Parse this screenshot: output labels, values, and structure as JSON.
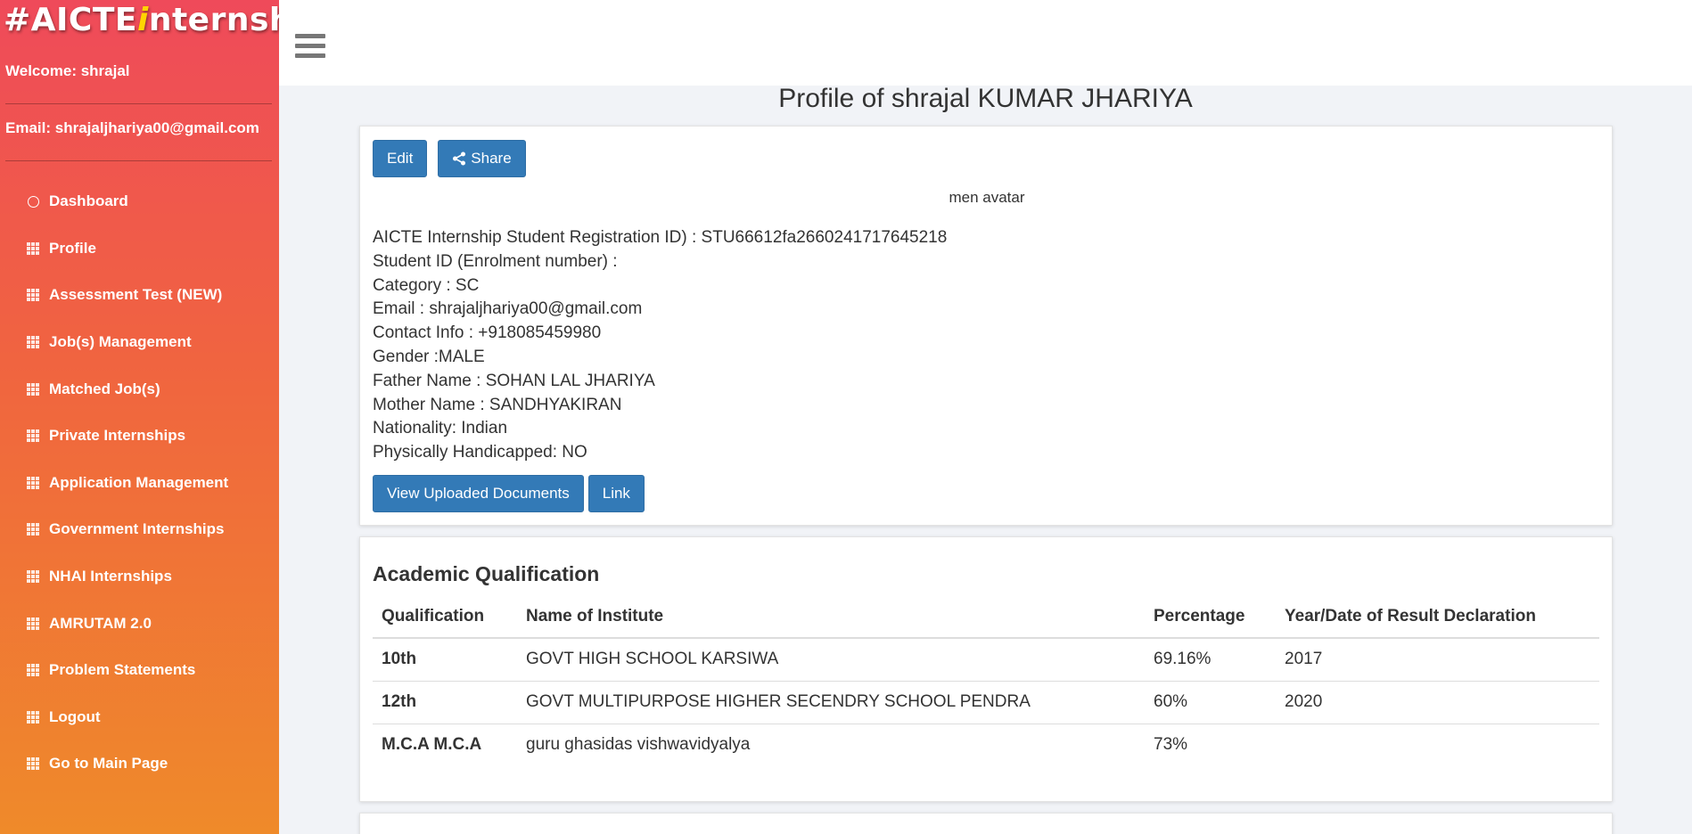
{
  "sidebar": {
    "logo_hash": "#AICTE",
    "logo_i": "i",
    "logo_rest": "nternship",
    "welcome": "Welcome: shrajal",
    "email": "Email: shrajaljhariya00@gmail.com",
    "items": [
      {
        "label": "Dashboard",
        "icon": "circle-icon"
      },
      {
        "label": "Profile",
        "icon": "grid-icon"
      },
      {
        "label": "Assessment Test (NEW)",
        "icon": "grid-icon"
      },
      {
        "label": "Job(s) Management",
        "icon": "grid-icon"
      },
      {
        "label": "Matched Job(s)",
        "icon": "grid-icon"
      },
      {
        "label": "Private Internships",
        "icon": "grid-icon"
      },
      {
        "label": "Application Management",
        "icon": "grid-icon"
      },
      {
        "label": "Government Internships",
        "icon": "grid-icon"
      },
      {
        "label": "NHAI Internships",
        "icon": "grid-icon"
      },
      {
        "label": "AMRUTAM 2.0",
        "icon": "grid-icon"
      },
      {
        "label": "Problem Statements",
        "icon": "grid-icon"
      },
      {
        "label": "Logout",
        "icon": "grid-icon"
      },
      {
        "label": "Go to Main Page",
        "icon": "grid-icon"
      }
    ]
  },
  "header": {
    "menu_icon": "hamburger-icon"
  },
  "profile": {
    "title": "Profile of shrajal KUMAR JHARIYA",
    "edit_label": "Edit",
    "share_label": "Share",
    "avatar_alt": "men avatar",
    "info": [
      "AICTE Internship Student Registration ID) : STU66612fa2660241717645218",
      "Student ID (Enrolment number) :",
      "Category : SC",
      "Email : shrajaljhariya00@gmail.com",
      "Contact Info : +918085459980",
      "Gender :MALE",
      "Father Name : SOHAN LAL JHARIYA",
      "Mother Name : SANDHYAKIRAN",
      "Nationality: Indian",
      "Physically Handicapped: NO"
    ],
    "view_docs_label": "View Uploaded Documents",
    "link_label": "Link"
  },
  "academic": {
    "title": "Academic Qualification",
    "columns": [
      "Qualification",
      "Name of Institute",
      "Percentage",
      "Year/Date of Result Declaration"
    ],
    "rows": [
      [
        "10th",
        "GOVT HIGH SCHOOL KARSIWA",
        "69.16%",
        "2017"
      ],
      [
        "12th",
        "GOVT MULTIPURPOSE HIGHER SECENDRY SCHOOL PENDRA",
        "60%",
        "2020"
      ],
      [
        "M.C.A M.C.A",
        "guru ghasidas vishwavidyalya",
        "73%",
        ""
      ]
    ]
  },
  "colors": {
    "sidebar_top": "#ef4a5a",
    "sidebar_bottom": "#ef8a2a",
    "button_blue": "#337ab7"
  }
}
